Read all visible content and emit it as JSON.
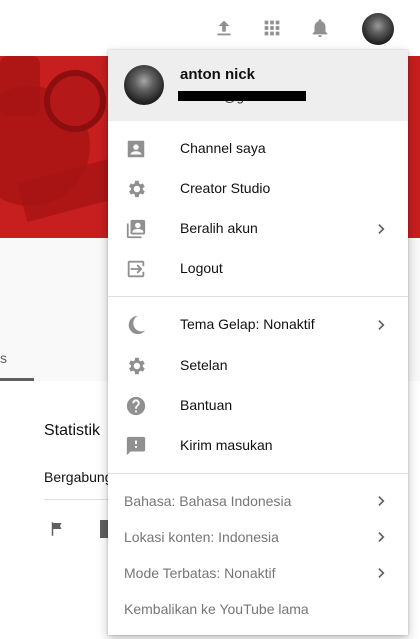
{
  "topbar": {
    "icons": [
      "upload-icon",
      "apps-grid-icon",
      "notifications-bell-icon"
    ],
    "avatar": "account-avatar"
  },
  "channel": {
    "tab_fragment": "s",
    "stats_title": "Statistik",
    "joined_label": "Bergabung"
  },
  "menu": {
    "account": {
      "name": "anton nick",
      "email": "anton...@gmail.com"
    },
    "section1": [
      {
        "label": "Channel saya",
        "icon": "account-box-icon"
      },
      {
        "label": "Creator Studio",
        "icon": "gear-icon"
      },
      {
        "label": "Beralih akun",
        "icon": "switch-account-icon",
        "chevron": true
      },
      {
        "label": "Logout",
        "icon": "logout-icon"
      }
    ],
    "section2": [
      {
        "label": "Tema Gelap: Nonaktif",
        "icon": "moon-icon",
        "chevron": true
      },
      {
        "label": "Setelan",
        "icon": "settings-icon"
      },
      {
        "label": "Bantuan",
        "icon": "help-icon"
      },
      {
        "label": "Kirim masukan",
        "icon": "feedback-icon"
      }
    ],
    "section3": [
      {
        "label": "Bahasa: Bahasa Indonesia",
        "chevron": true
      },
      {
        "label": "Lokasi konten: Indonesia",
        "chevron": true
      },
      {
        "label": "Mode Terbatas: Nonaktif",
        "chevron": true
      },
      {
        "label": "Kembalikan ke YouTube lama"
      }
    ]
  },
  "colors": {
    "banner_red": "#c71f1f",
    "menu_header_bg": "#eeeeee",
    "icon_gray": "#909090"
  }
}
